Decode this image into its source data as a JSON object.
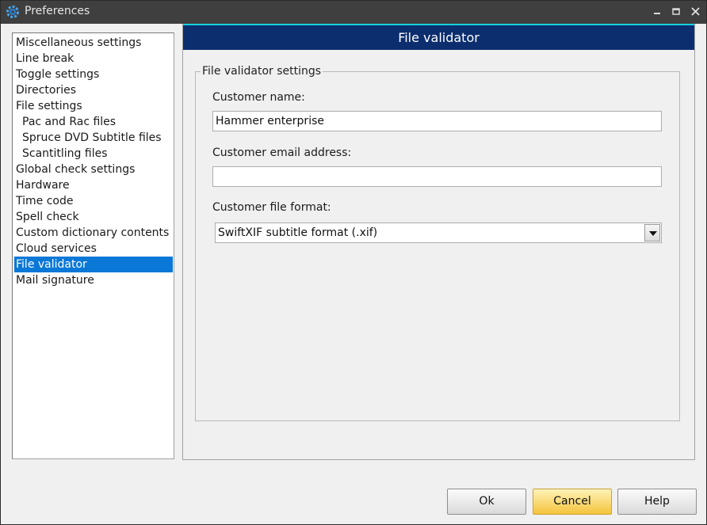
{
  "window": {
    "title": "Preferences",
    "icon": "gear-icon",
    "controls": {
      "minimize": "minimize-icon",
      "maximize": "maximize-icon",
      "close": "close-icon"
    }
  },
  "sidebar": {
    "items": [
      {
        "label": "Miscellaneous settings",
        "level": 0
      },
      {
        "label": "Line break",
        "level": 0
      },
      {
        "label": "Toggle settings",
        "level": 0
      },
      {
        "label": "Directories",
        "level": 0
      },
      {
        "label": "File settings",
        "level": 0
      },
      {
        "label": "Pac and Rac files",
        "level": 1
      },
      {
        "label": "Spruce DVD Subtitle files",
        "level": 1
      },
      {
        "label": "Scantitling files",
        "level": 1
      },
      {
        "label": "Global check settings",
        "level": 0
      },
      {
        "label": "Hardware",
        "level": 0
      },
      {
        "label": "Time code",
        "level": 0
      },
      {
        "label": "Spell check",
        "level": 0
      },
      {
        "label": "Custom dictionary contents",
        "level": 0
      },
      {
        "label": "Cloud services",
        "level": 0
      },
      {
        "label": "File validator",
        "level": 0,
        "selected": true
      },
      {
        "label": "Mail signature",
        "level": 0
      }
    ]
  },
  "panel": {
    "title": "File validator",
    "group_title": "File validator settings",
    "customer_name": {
      "label": "Customer name:",
      "value": "Hammer enterprise"
    },
    "customer_email": {
      "label": "Customer email address:",
      "value": ""
    },
    "customer_format": {
      "label": "Customer file format:",
      "selected": "SwiftXIF subtitle format (.xif)"
    }
  },
  "buttons": {
    "ok": "Ok",
    "cancel": "Cancel",
    "help": "Help"
  },
  "colors": {
    "header_bg": "#0c2e6e",
    "header_accent": "#16d0e0",
    "selection": "#0a78d7",
    "cancel_button": "#f4c43c"
  }
}
